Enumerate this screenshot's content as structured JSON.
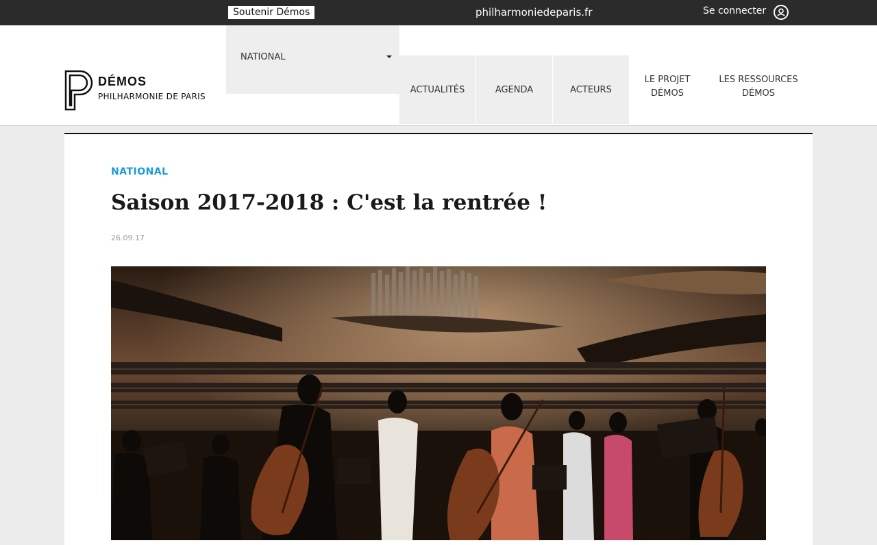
{
  "topbar": {
    "support_label": "Soutenir Démos",
    "site_link": "philharmoniedeparis.fr",
    "login_label": "Se connecter"
  },
  "logo": {
    "brand": "DÉMOS",
    "subtitle": "PHILHARMONIE DE PARIS"
  },
  "nav": {
    "dropdown": "NATIONAL",
    "actualites": "ACTUALITÉS",
    "agenda": "AGENDA",
    "acteurs": "ACTEURS",
    "projet_line1": "LE PROJET",
    "projet_line2": "DÉMOS",
    "ressources_line1": "LES RESSOURCES",
    "ressources_line2": "DÉMOS"
  },
  "article": {
    "category": "NATIONAL",
    "title": "Saison 2017-2018 : C'est la rentrée !",
    "date": "26.09.17"
  },
  "colors": {
    "accent": "#1a9bd7",
    "topbar": "#2b2b2b",
    "nav_bg": "#eeeeee"
  }
}
